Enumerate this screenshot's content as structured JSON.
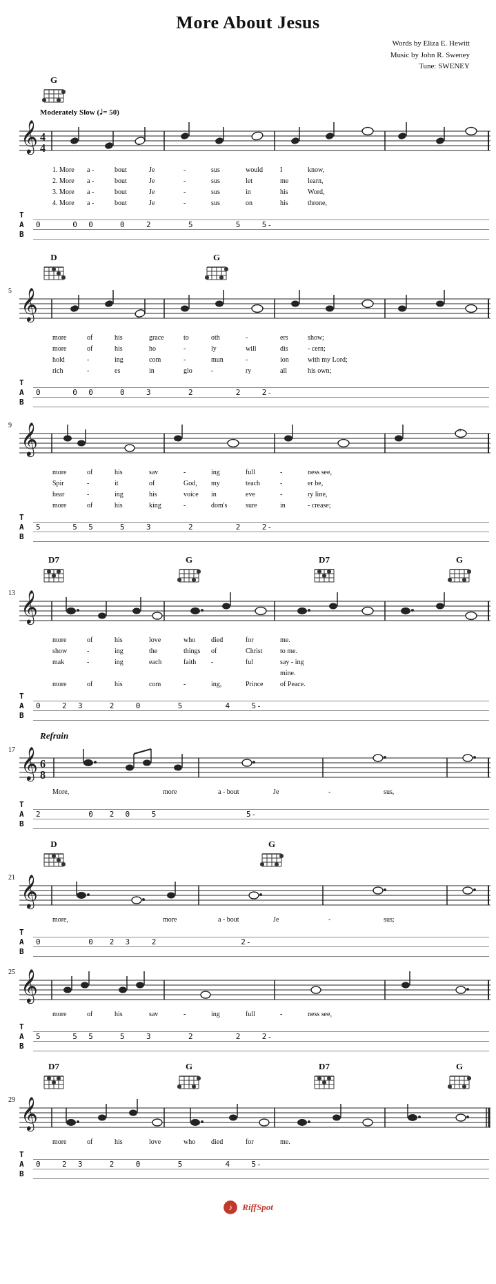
{
  "title": "More About Jesus",
  "attribution": {
    "line1": "Words by Eliza E. Hewitt",
    "line2": "Music by John R. Sweney",
    "line3": "Tune: SWENEY"
  },
  "tempo": "Moderately Slow (♩= 50)",
  "sections": [
    {
      "id": "verse",
      "chords_left": [
        {
          "name": "G",
          "fret": ""
        }
      ],
      "measure_start": 1,
      "lyrics": [
        "1. More   a - bout   Je  -  sus   would   I    know,",
        "2. More   a - bout   Je  -  sus   let     me   learn,",
        "3. More   a - bout   Je  -  sus   in      his  Word,",
        "4. More   a - bout   Je  -  sus   on      his  throne,"
      ],
      "tab": {
        "T": "T",
        "A": "A",
        "B": "B",
        "line": "0       0  0     0    2      5        5    5-"
      }
    }
  ],
  "refrain_label": "Refrain",
  "footer": {
    "brand": "RiffSpot",
    "icon": "♪"
  },
  "lyrics_verse1": [
    [
      "1. More",
      "a -",
      "bout",
      "Je",
      "-",
      "sus",
      "would",
      "I",
      "know,"
    ],
    [
      "2. More",
      "a -",
      "bout",
      "Je",
      "-",
      "sus",
      "let",
      "me",
      "learn,"
    ],
    [
      "3. More",
      "a -",
      "bout",
      "Je",
      "-",
      "sus",
      "in",
      "his",
      "Word,"
    ],
    [
      "4. More",
      "a -",
      "bout",
      "Je",
      "-",
      "sus",
      "on",
      "his",
      "throne,"
    ]
  ],
  "lyrics_verse2": [
    [
      "more",
      "of",
      "his",
      "grace",
      "to",
      "oth",
      "-",
      "ers",
      "show;"
    ],
    [
      "more",
      "of",
      "his",
      "ho",
      "-",
      "ly",
      "will",
      "dis",
      "-",
      "cern;"
    ],
    [
      "hold",
      "-",
      "ing",
      "com",
      "-",
      "mun",
      "-",
      "ion",
      "with",
      "my",
      "Lord;"
    ],
    [
      "rich",
      "-",
      "es",
      "in",
      "glo",
      "-",
      "ry",
      "all",
      "his",
      "own;"
    ]
  ],
  "lyrics_verse3": [
    [
      "more",
      "of",
      "his",
      "sav",
      "-",
      "ing",
      "full",
      "-",
      "ness",
      "see,"
    ],
    [
      "Spir",
      "-",
      "it",
      "of",
      "God,",
      "my",
      "teach",
      "-",
      "er",
      "be,"
    ],
    [
      "hear",
      "-",
      "ing",
      "his",
      "voice",
      "in",
      "eve",
      "-",
      "ry",
      "line,"
    ],
    [
      "more",
      "of",
      "his",
      "king",
      "-",
      "dom's",
      "sure",
      "in",
      "-",
      "crease;"
    ]
  ],
  "lyrics_verse4": [
    [
      "more",
      "of",
      "his",
      "love",
      "who",
      "died",
      "for",
      "me."
    ],
    [
      "show",
      "-",
      "ing",
      "the",
      "things",
      "of",
      "Christ",
      "to",
      "me."
    ],
    [
      "mak",
      "-",
      "ing",
      "each",
      "faith",
      "-",
      "ful",
      "say",
      "-",
      "ing",
      "mine."
    ],
    [
      "more",
      "of",
      "his",
      "com",
      "-",
      "ing,",
      "Prince",
      "of",
      "Peace."
    ]
  ],
  "lyrics_refrain1": [
    "More,",
    "",
    "more",
    "a - bout",
    "Je",
    "-",
    "sus,"
  ],
  "lyrics_refrain2": [
    "more,",
    "",
    "more",
    "a - bout",
    "Je",
    "-",
    "sus;"
  ],
  "lyrics_refrain3": [
    "more",
    "of",
    "his",
    "sav",
    "-",
    "ing",
    "full",
    "-",
    "ness",
    "see,"
  ],
  "lyrics_refrain4": [
    "more",
    "of",
    "his",
    "love",
    "who",
    "died",
    "for",
    "me."
  ]
}
